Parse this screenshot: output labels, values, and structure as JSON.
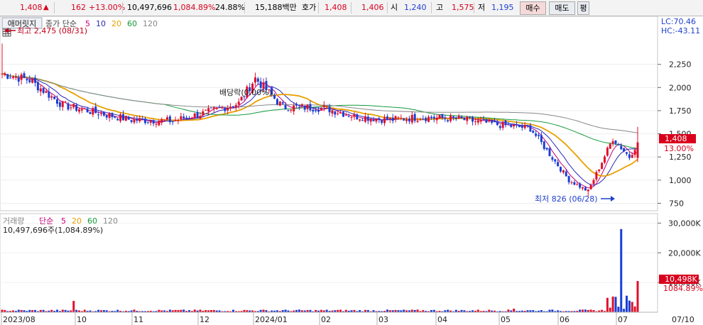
{
  "quote_bar": {
    "price": "1,408",
    "arrow": "▲",
    "change": "162",
    "change_pct": "+13.00%",
    "volume": "10,497,696",
    "volume_ratio": "1,084.89%",
    "turnover": "24.88%",
    "trade_value": "15,188백만",
    "bid_label": "호가",
    "bid": "1,408",
    "ask": "1,406",
    "open_label": "시",
    "open": "1,240",
    "high_label": "고",
    "high": "1,575",
    "low_label": "저",
    "low": "1,195",
    "buy_button": "매수",
    "sell_button": "매도",
    "eval_button": "평"
  },
  "price_pane": {
    "indicator_tab": "애머릿지",
    "ma_label": "종가 단순",
    "ma_periods": [
      "5",
      "10",
      "20",
      "60",
      "120"
    ],
    "ma_colors": [
      "#c2007a",
      "#2a2ab8",
      "#e8a000",
      "#129a3a",
      "#888888"
    ],
    "high_marker": "최고 2,475 (08/31)",
    "low_marker": "최저 826 (06/28)",
    "dividend_marker": "배당락(0.00%)",
    "lc_label": "LC:70.46",
    "hc_label": "HC:-43.11",
    "price_tag": "1,408",
    "pct_tag": "13.00%",
    "y_ticks": [
      "2,250",
      "2,000",
      "1,750",
      "1,500",
      "1,250",
      "1,000",
      "750"
    ]
  },
  "volume_pane": {
    "title": "거래량",
    "ma_label": "단순",
    "ma_periods": [
      "5",
      "20",
      "60",
      "120"
    ],
    "readout": "10,497,696주(1,084.89%)",
    "vol_tag": "10,498K",
    "vol_pct_tag": "1084.89%",
    "y_ticks": [
      "30,000K",
      "20,000K",
      "10,000K"
    ]
  },
  "x_axis": {
    "labels": [
      "2023/08",
      "10",
      "11",
      "12",
      "2024/01",
      "02",
      "03",
      "04",
      "05",
      "06",
      "07",
      "07/10"
    ]
  },
  "chart_data": {
    "type": "candlestick",
    "series": [
      {
        "name": "종가",
        "x": [
          "2023/08/31",
          "2023/09/15",
          "2023/10/04",
          "2023/10/20",
          "2023/11/08",
          "2023/11/30",
          "2023/12/15",
          "2024/01/02",
          "2024/01/10",
          "2024/01/26",
          "2024/02/15",
          "2024/03/01",
          "2024/03/20",
          "2024/04/05",
          "2024/04/25",
          "2024/05/15",
          "2024/06/03",
          "2024/06/20",
          "2024/06/28",
          "2024/07/04",
          "2024/07/08",
          "2024/07/09"
        ],
        "values": [
          2150,
          2080,
          1810,
          1730,
          1650,
          1640,
          1720,
          1830,
          2100,
          1790,
          1780,
          1690,
          1650,
          1680,
          1660,
          1600,
          1560,
          1000,
          880,
          1450,
          1250,
          1408
        ]
      }
    ],
    "events": [
      {
        "date": "2023/08/31",
        "label": "최고 2,475 (08/31)",
        "value": 2475
      },
      {
        "date": "2024/06/28",
        "label": "최저 826 (06/28)",
        "value": 826
      }
    ],
    "last": {
      "open": 1240,
      "high": 1575,
      "low": 1195,
      "close": 1408,
      "volume": 10497696
    },
    "ylim": [
      700,
      2600
    ],
    "volume_ylim": [
      0,
      32000000
    ]
  }
}
